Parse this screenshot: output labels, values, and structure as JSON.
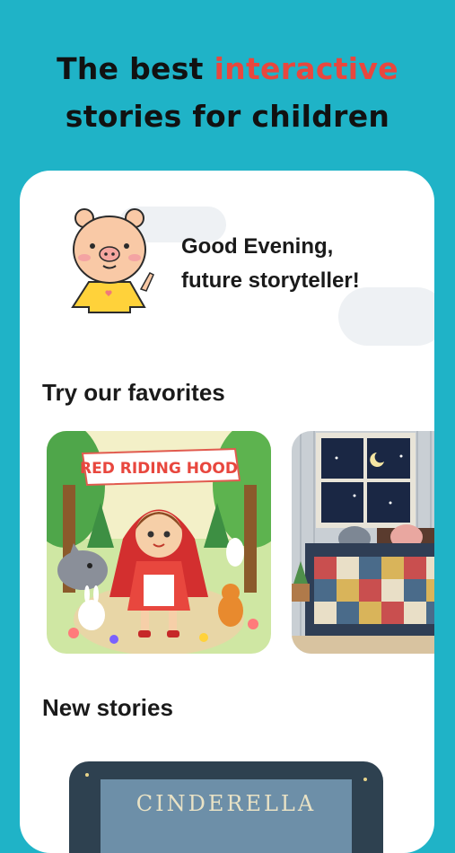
{
  "hero": {
    "title_line1_prefix": "The best",
    "title_line1_accent": "interactive",
    "title_line2": "stories for children",
    "accent_color": "#e8473e",
    "background_color": "#1fb3c7"
  },
  "greeting": {
    "line1": "Good Evening,",
    "line2": "future storyteller!",
    "mascot_icon": "pig-mascot-icon"
  },
  "favorites": {
    "title": "Try our favorites",
    "items": [
      {
        "title": "RED RIDING HOOD"
      },
      {
        "title": ""
      }
    ]
  },
  "new_stories": {
    "title": "New stories",
    "items": [
      {
        "title": "CINDERELLA"
      }
    ]
  }
}
